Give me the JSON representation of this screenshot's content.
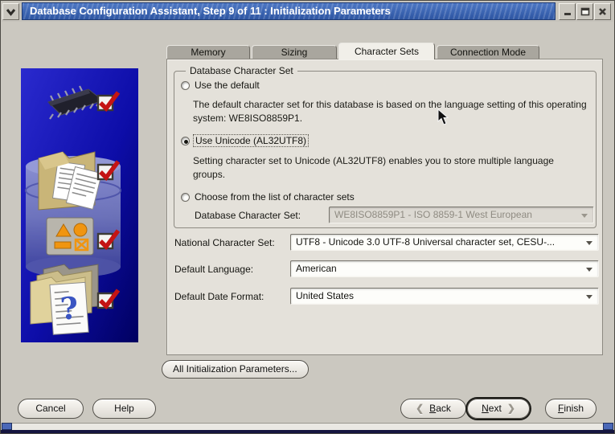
{
  "window": {
    "title": "Database Configuration Assistant, Step 9 of 11 : Initialization Parameters",
    "controls": [
      "window-menu",
      "minimize",
      "maximize",
      "close"
    ]
  },
  "sidebar": {
    "icons": [
      "memory-chip",
      "database-documents",
      "storage-shapes",
      "help-folders"
    ],
    "completed_steps": 4,
    "check_color": "#c41414",
    "background_color": "#0000a0"
  },
  "tabs": [
    {
      "label": "Memory"
    },
    {
      "label": "Sizing"
    },
    {
      "label": "Character Sets",
      "active": true
    },
    {
      "label": "Connection Mode"
    }
  ],
  "charset_panel": {
    "group_title": "Database Character Set",
    "use_default": {
      "label": "Use the default",
      "selected": false,
      "description": "The default character set for this database is based on the language setting of this operating system: WE8ISO8859P1."
    },
    "use_unicode": {
      "label": "Use Unicode (AL32UTF8)",
      "selected": true,
      "description": "Setting character set to Unicode (AL32UTF8) enables you to store multiple language groups."
    },
    "choose_list": {
      "label": "Choose from the list of character sets",
      "selected": false
    },
    "db_charset": {
      "label": "Database Character Set:",
      "value": "WE8ISO8859P1 - ISO 8859-1 West European",
      "disabled": true
    },
    "national_charset": {
      "label": "National Character Set:",
      "value": "UTF8 - Unicode 3.0 UTF-8 Universal character set, CESU-..."
    },
    "default_language": {
      "label": "Default Language:",
      "value": "American"
    },
    "default_date_format": {
      "label": "Default Date Format:",
      "value": "United States"
    },
    "all_params_button": "All Initialization Parameters..."
  },
  "footer": {
    "cancel": "Cancel",
    "help": "Help",
    "back": {
      "mnemonic": "B",
      "rest": "ack",
      "icon": "❮"
    },
    "next": {
      "mnemonic": "N",
      "rest": "ext",
      "icon": "❯"
    },
    "finish": {
      "mnemonic": "F",
      "rest": "inish"
    }
  }
}
